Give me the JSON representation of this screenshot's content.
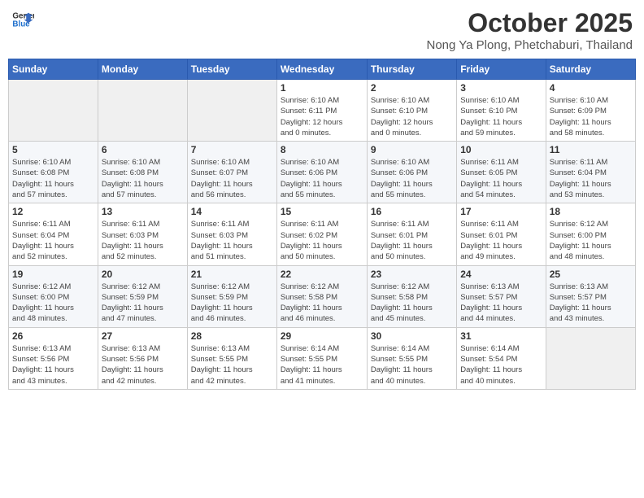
{
  "header": {
    "logo_line1": "General",
    "logo_line2": "Blue",
    "month": "October 2025",
    "location": "Nong Ya Plong, Phetchaburi, Thailand"
  },
  "weekdays": [
    "Sunday",
    "Monday",
    "Tuesday",
    "Wednesday",
    "Thursday",
    "Friday",
    "Saturday"
  ],
  "weeks": [
    [
      {
        "day": "",
        "info": ""
      },
      {
        "day": "",
        "info": ""
      },
      {
        "day": "",
        "info": ""
      },
      {
        "day": "1",
        "info": "Sunrise: 6:10 AM\nSunset: 6:11 PM\nDaylight: 12 hours\nand 0 minutes."
      },
      {
        "day": "2",
        "info": "Sunrise: 6:10 AM\nSunset: 6:10 PM\nDaylight: 12 hours\nand 0 minutes."
      },
      {
        "day": "3",
        "info": "Sunrise: 6:10 AM\nSunset: 6:10 PM\nDaylight: 11 hours\nand 59 minutes."
      },
      {
        "day": "4",
        "info": "Sunrise: 6:10 AM\nSunset: 6:09 PM\nDaylight: 11 hours\nand 58 minutes."
      }
    ],
    [
      {
        "day": "5",
        "info": "Sunrise: 6:10 AM\nSunset: 6:08 PM\nDaylight: 11 hours\nand 57 minutes."
      },
      {
        "day": "6",
        "info": "Sunrise: 6:10 AM\nSunset: 6:08 PM\nDaylight: 11 hours\nand 57 minutes."
      },
      {
        "day": "7",
        "info": "Sunrise: 6:10 AM\nSunset: 6:07 PM\nDaylight: 11 hours\nand 56 minutes."
      },
      {
        "day": "8",
        "info": "Sunrise: 6:10 AM\nSunset: 6:06 PM\nDaylight: 11 hours\nand 55 minutes."
      },
      {
        "day": "9",
        "info": "Sunrise: 6:10 AM\nSunset: 6:06 PM\nDaylight: 11 hours\nand 55 minutes."
      },
      {
        "day": "10",
        "info": "Sunrise: 6:11 AM\nSunset: 6:05 PM\nDaylight: 11 hours\nand 54 minutes."
      },
      {
        "day": "11",
        "info": "Sunrise: 6:11 AM\nSunset: 6:04 PM\nDaylight: 11 hours\nand 53 minutes."
      }
    ],
    [
      {
        "day": "12",
        "info": "Sunrise: 6:11 AM\nSunset: 6:04 PM\nDaylight: 11 hours\nand 52 minutes."
      },
      {
        "day": "13",
        "info": "Sunrise: 6:11 AM\nSunset: 6:03 PM\nDaylight: 11 hours\nand 52 minutes."
      },
      {
        "day": "14",
        "info": "Sunrise: 6:11 AM\nSunset: 6:03 PM\nDaylight: 11 hours\nand 51 minutes."
      },
      {
        "day": "15",
        "info": "Sunrise: 6:11 AM\nSunset: 6:02 PM\nDaylight: 11 hours\nand 50 minutes."
      },
      {
        "day": "16",
        "info": "Sunrise: 6:11 AM\nSunset: 6:01 PM\nDaylight: 11 hours\nand 50 minutes."
      },
      {
        "day": "17",
        "info": "Sunrise: 6:11 AM\nSunset: 6:01 PM\nDaylight: 11 hours\nand 49 minutes."
      },
      {
        "day": "18",
        "info": "Sunrise: 6:12 AM\nSunset: 6:00 PM\nDaylight: 11 hours\nand 48 minutes."
      }
    ],
    [
      {
        "day": "19",
        "info": "Sunrise: 6:12 AM\nSunset: 6:00 PM\nDaylight: 11 hours\nand 48 minutes."
      },
      {
        "day": "20",
        "info": "Sunrise: 6:12 AM\nSunset: 5:59 PM\nDaylight: 11 hours\nand 47 minutes."
      },
      {
        "day": "21",
        "info": "Sunrise: 6:12 AM\nSunset: 5:59 PM\nDaylight: 11 hours\nand 46 minutes."
      },
      {
        "day": "22",
        "info": "Sunrise: 6:12 AM\nSunset: 5:58 PM\nDaylight: 11 hours\nand 46 minutes."
      },
      {
        "day": "23",
        "info": "Sunrise: 6:12 AM\nSunset: 5:58 PM\nDaylight: 11 hours\nand 45 minutes."
      },
      {
        "day": "24",
        "info": "Sunrise: 6:13 AM\nSunset: 5:57 PM\nDaylight: 11 hours\nand 44 minutes."
      },
      {
        "day": "25",
        "info": "Sunrise: 6:13 AM\nSunset: 5:57 PM\nDaylight: 11 hours\nand 43 minutes."
      }
    ],
    [
      {
        "day": "26",
        "info": "Sunrise: 6:13 AM\nSunset: 5:56 PM\nDaylight: 11 hours\nand 43 minutes."
      },
      {
        "day": "27",
        "info": "Sunrise: 6:13 AM\nSunset: 5:56 PM\nDaylight: 11 hours\nand 42 minutes."
      },
      {
        "day": "28",
        "info": "Sunrise: 6:13 AM\nSunset: 5:55 PM\nDaylight: 11 hours\nand 42 minutes."
      },
      {
        "day": "29",
        "info": "Sunrise: 6:14 AM\nSunset: 5:55 PM\nDaylight: 11 hours\nand 41 minutes."
      },
      {
        "day": "30",
        "info": "Sunrise: 6:14 AM\nSunset: 5:55 PM\nDaylight: 11 hours\nand 40 minutes."
      },
      {
        "day": "31",
        "info": "Sunrise: 6:14 AM\nSunset: 5:54 PM\nDaylight: 11 hours\nand 40 minutes."
      },
      {
        "day": "",
        "info": ""
      }
    ]
  ]
}
